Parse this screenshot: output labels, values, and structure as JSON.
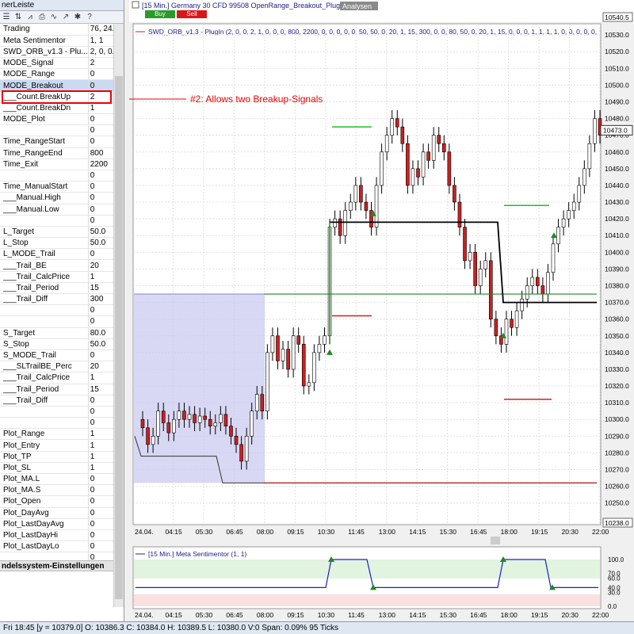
{
  "left_panel": {
    "title": "nerLeiste",
    "toolbar_icons": [
      "list-icon",
      "sort-icon",
      "chart-icon",
      "print-icon",
      "line-icon",
      "indicator-icon",
      "settings-icon",
      "help-icon"
    ],
    "rows": [
      {
        "name": "Trading",
        "value": "76, 24..."
      },
      {
        "name": "Meta Sentimentor",
        "value": "1, 1"
      },
      {
        "name": "SWD_ORB_v1.3 - Plu...",
        "value": "2, 0, 0..."
      },
      {
        "name": "MODE_Signal",
        "value": "2"
      },
      {
        "name": "MODE_Range",
        "value": "0"
      },
      {
        "name": "MODE_Breakout",
        "value": "0"
      },
      {
        "name": "___Count.BreakUp",
        "value": "2"
      },
      {
        "name": "___Count.BreakDn",
        "value": "1"
      },
      {
        "name": "MODE_Plot",
        "value": "0"
      },
      {
        "name": "",
        "value": "0"
      },
      {
        "name": "Time_RangeStart",
        "value": "0"
      },
      {
        "name": "Time_RangeEnd",
        "value": "800"
      },
      {
        "name": "Time_Exit",
        "value": "2200"
      },
      {
        "name": "",
        "value": "0"
      },
      {
        "name": "Time_ManualStart",
        "value": "0"
      },
      {
        "name": "___Manual.High",
        "value": "0"
      },
      {
        "name": "___Manual.Low",
        "value": "0"
      },
      {
        "name": "",
        "value": "0"
      },
      {
        "name": "L_Target",
        "value": "50.0"
      },
      {
        "name": "L_Stop",
        "value": "50.0"
      },
      {
        "name": "L_MODE_Trail",
        "value": "0"
      },
      {
        "name": "___Trail_BE",
        "value": "20"
      },
      {
        "name": "___Trail_CalcPrice",
        "value": "1"
      },
      {
        "name": "___Trail_Period",
        "value": "15"
      },
      {
        "name": "___Trail_Diff",
        "value": "300"
      },
      {
        "name": "",
        "value": "0"
      },
      {
        "name": "",
        "value": "0"
      },
      {
        "name": "S_Target",
        "value": "80.0"
      },
      {
        "name": "S_Stop",
        "value": "50.0"
      },
      {
        "name": "S_MODE_Trail",
        "value": "0"
      },
      {
        "name": "___SLTrailBE_Perc",
        "value": "20"
      },
      {
        "name": "___Trail_CalcPrice",
        "value": "1"
      },
      {
        "name": "___Trail_Period",
        "value": "15"
      },
      {
        "name": "___Trail_Diff",
        "value": "0"
      },
      {
        "name": "",
        "value": "0"
      },
      {
        "name": "",
        "value": "0"
      },
      {
        "name": "Plot_Range",
        "value": "1"
      },
      {
        "name": "Plot_Entry",
        "value": "1"
      },
      {
        "name": "Plot_TP",
        "value": "1"
      },
      {
        "name": "Plot_SL",
        "value": "1"
      },
      {
        "name": "Plot_MA.L",
        "value": "0"
      },
      {
        "name": "Plot_MA.S",
        "value": "0"
      },
      {
        "name": "Plot_Open",
        "value": "0"
      },
      {
        "name": "Plot_DayAvg",
        "value": "0"
      },
      {
        "name": "Plot_LastDayAvg",
        "value": "0"
      },
      {
        "name": "Plot_LastDayHi",
        "value": "0"
      },
      {
        "name": "Plot_LastDayLo",
        "value": "0"
      },
      {
        "name": "",
        "value": "0"
      }
    ],
    "section_label": "ndelssystem-Einstellungen"
  },
  "chart": {
    "header": "[15 Min.] Germany 30 CFD   99508 OpenRange_Breakout_PlugIn",
    "analysen_label": "Analysen",
    "buy_label": "Buy",
    "sell_label": "Sell",
    "indicator_label": "SWD_ORB_v1.3 - PlugIn  (2, 0, 0, 2, 1, 0, 0, 0, 800, 2200, 0, 0, 0, 0, 0, 50, 50, 0, 20, 1, 15, 300, 0, 0, 80, 50, 0, 20, 1, 15, 0, 0, 0, 1, 1, 1, 1, 0, 0, 0, 0, 0,",
    "annotation": "#2: Allows two Breakup-Signals",
    "price_labels": [
      "10540.5",
      "10530.0",
      "10520.0",
      "10510.0",
      "10500.0",
      "10490.0",
      "10480.0",
      "10470.0",
      "10460.0",
      "10450.0",
      "10440.0",
      "10430.0",
      "10420.0",
      "10410.0",
      "10400.0",
      "10390.0",
      "10380.0",
      "10370.0",
      "10360.0",
      "10350.0",
      "10340.0",
      "10330.0",
      "10320.0",
      "10310.0",
      "10300.0",
      "10290.0",
      "10280.0",
      "10270.0",
      "10260.0",
      "10250.0",
      "10238.0"
    ],
    "current_price": "10473.0",
    "time_labels": [
      "24.04.",
      "04:15",
      "05:30",
      "06:45",
      "08:00",
      "09:15",
      "10:30",
      "11:45",
      "13:00",
      "14:15",
      "15:30",
      "16:45",
      "18:00",
      "19:15",
      "20:30",
      "22:00"
    ]
  },
  "subchart": {
    "label": "[15 Min.] Meta Sentimentor  (1, 1)",
    "y_labels": [
      "100.0",
      "70.0",
      "60.0",
      "40.0",
      "30.0",
      "0.0"
    ],
    "time_labels": [
      "24.04.",
      "04:15",
      "05:30",
      "06:45",
      "08:00",
      "09:15",
      "10:30",
      "11:45",
      "13:00",
      "14:15",
      "15:30",
      "16:45",
      "18:00",
      "19:15",
      "20:30",
      "22:00"
    ]
  },
  "status_bar": "Fri  18:45  [y = 10379.0]          O: 10386.3  C: 10384.0  H: 10389.5  L: 10380.0  V:0  Span: 0.09%  95 Ticks",
  "colors": {
    "up": "#ffffff",
    "down": "#cc2020",
    "range_fill": "#c8c8f0",
    "target_line": "#20c020",
    "stop_line": "#b01010",
    "indicator": "#2020a0"
  }
}
